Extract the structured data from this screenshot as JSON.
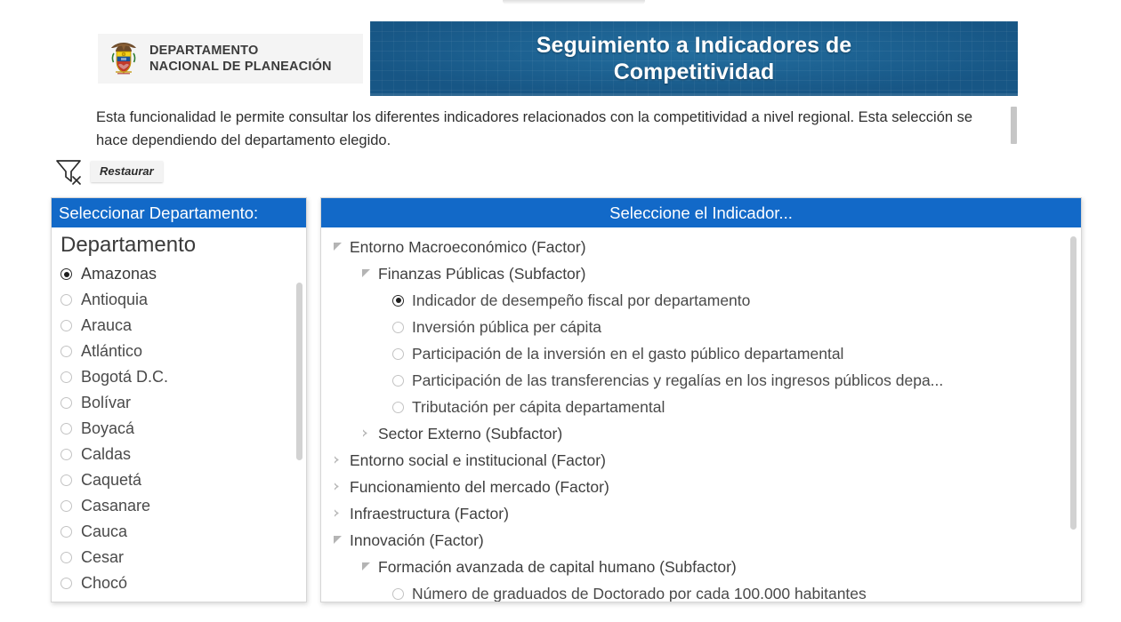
{
  "header": {
    "org_name": "DEPARTAMENTO\nNACIONAL DE PLANEACIÓN",
    "banner_title": "Seguimiento a Indicadores de\nCompetitividad",
    "banner_color": "#1a5c8e",
    "accent_color": "#1269c8"
  },
  "description": {
    "text": "Esta funcionalidad le permite consultar los diferentes indicadores relacionados con la competitividad a nivel regional. Esta selección se hace dependiendo del departamento elegido."
  },
  "toolbar": {
    "restore_label": "Restaurar",
    "filter_icon": "clear-filter-icon"
  },
  "dept_panel": {
    "header": "Seleccionar Departamento:",
    "group_label": "Departamento",
    "selected": "Amazonas",
    "items": [
      {
        "label": "Amazonas",
        "selected": true
      },
      {
        "label": "Antioquia",
        "selected": false
      },
      {
        "label": "Arauca",
        "selected": false
      },
      {
        "label": "Atlántico",
        "selected": false
      },
      {
        "label": "Bogotá D.C.",
        "selected": false
      },
      {
        "label": "Bolívar",
        "selected": false
      },
      {
        "label": "Boyacá",
        "selected": false
      },
      {
        "label": "Caldas",
        "selected": false
      },
      {
        "label": "Caquetá",
        "selected": false
      },
      {
        "label": "Casanare",
        "selected": false
      },
      {
        "label": "Cauca",
        "selected": false
      },
      {
        "label": "Cesar",
        "selected": false
      },
      {
        "label": "Chocó",
        "selected": false
      }
    ]
  },
  "tree_panel": {
    "header": "Seleccione el Indicador...",
    "nodes": [
      {
        "label": "Entorno Macroeconómico (Factor)",
        "level": 0,
        "type": "node",
        "state": "expanded"
      },
      {
        "label": "Finanzas Públicas (Subfactor)",
        "level": 1,
        "type": "node",
        "state": "expanded"
      },
      {
        "label": "Indicador de desempeño fiscal por departamento",
        "level": 2,
        "type": "leaf",
        "selected": true
      },
      {
        "label": "Inversión pública per cápita",
        "level": 2,
        "type": "leaf",
        "selected": false
      },
      {
        "label": "Participación de la inversión en el gasto público departamental",
        "level": 2,
        "type": "leaf",
        "selected": false
      },
      {
        "label": "Participación de las transferencias y regalías en los ingresos públicos depa...",
        "level": 2,
        "type": "leaf",
        "selected": false
      },
      {
        "label": "Tributación per cápita departamental",
        "level": 2,
        "type": "leaf",
        "selected": false
      },
      {
        "label": "Sector Externo (Subfactor)",
        "level": 1,
        "type": "node",
        "state": "collapsed"
      },
      {
        "label": "Entorno social e institucional (Factor)",
        "level": 0,
        "type": "node",
        "state": "collapsed"
      },
      {
        "label": "Funcionamiento del mercado (Factor)",
        "level": 0,
        "type": "node",
        "state": "collapsed"
      },
      {
        "label": "Infraestructura (Factor)",
        "level": 0,
        "type": "node",
        "state": "collapsed"
      },
      {
        "label": "Innovación (Factor)",
        "level": 0,
        "type": "node",
        "state": "expanded"
      },
      {
        "label": "Formación avanzada de capital humano (Subfactor)",
        "level": 1,
        "type": "node",
        "state": "expanded"
      },
      {
        "label": "Número de graduados de Doctorado por cada 100.000 habitantes",
        "level": 2,
        "type": "leaf",
        "selected": false
      }
    ]
  }
}
